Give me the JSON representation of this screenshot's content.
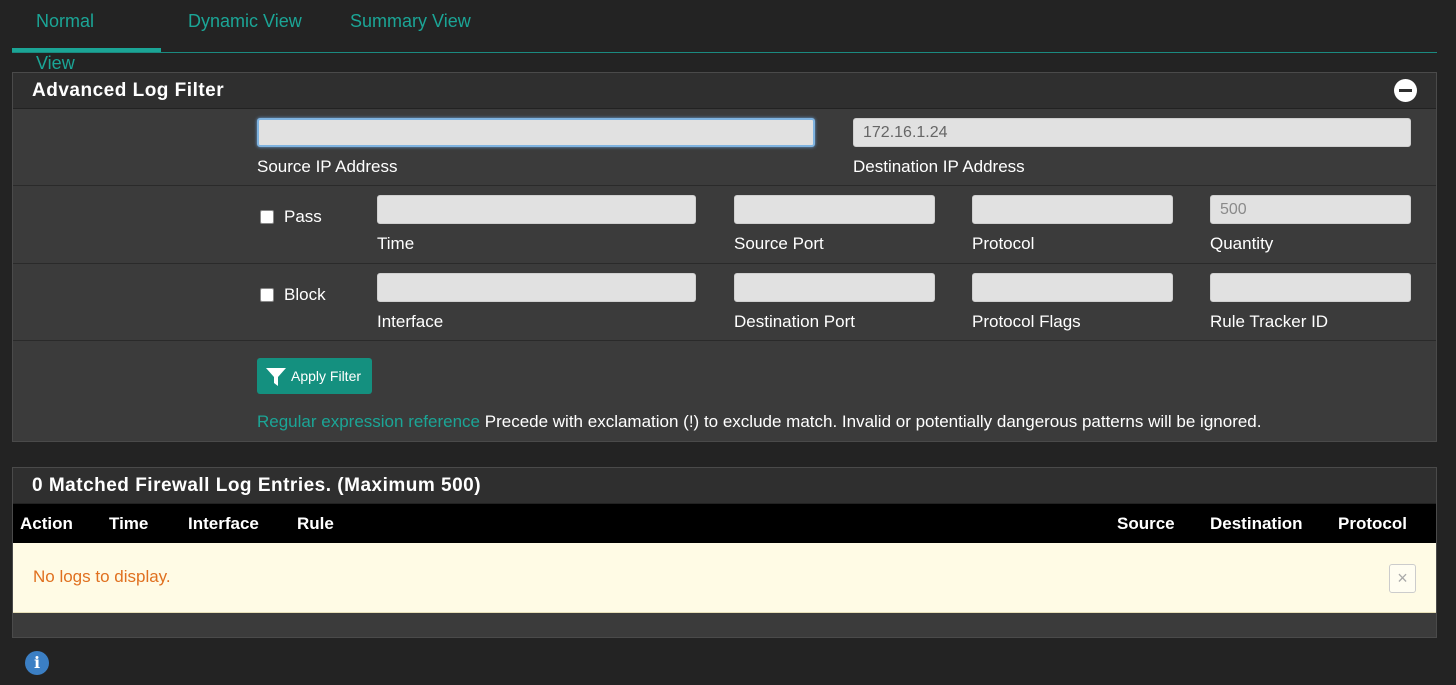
{
  "tabs": [
    {
      "label": "Normal View",
      "active": true
    },
    {
      "label": "Dynamic View",
      "active": false
    },
    {
      "label": "Summary View",
      "active": false
    }
  ],
  "filter_panel": {
    "title": "Advanced Log Filter",
    "source_ip": {
      "label": "Source IP Address",
      "value": ""
    },
    "destination_ip": {
      "label": "Destination IP Address",
      "value": "172.16.1.24"
    },
    "pass": {
      "label": "Pass",
      "checked": false
    },
    "block": {
      "label": "Block",
      "checked": false
    },
    "time": {
      "label": "Time",
      "value": ""
    },
    "source_port": {
      "label": "Source Port",
      "value": ""
    },
    "protocol": {
      "label": "Protocol",
      "value": ""
    },
    "quantity": {
      "label": "Quantity",
      "placeholder": "500"
    },
    "interface": {
      "label": "Interface",
      "value": ""
    },
    "destination_port": {
      "label": "Destination Port",
      "value": ""
    },
    "protocol_flags": {
      "label": "Protocol Flags",
      "value": ""
    },
    "rule_tracker_id": {
      "label": "Rule Tracker ID",
      "value": ""
    },
    "apply_label": "Apply Filter",
    "regex_link": "Regular expression reference",
    "hint_text": " Precede with exclamation (!) to exclude match. Invalid or potentially dangerous patterns will be ignored."
  },
  "log_panel": {
    "title": "0 Matched Firewall Log Entries. (Maximum 500)",
    "columns": [
      "Action",
      "Time",
      "Interface",
      "Rule",
      "Source",
      "Destination",
      "Protocol"
    ],
    "empty_message": "No logs to display.",
    "close_glyph": "×"
  },
  "info_glyph": "i",
  "colors": {
    "accent": "#1ba596",
    "alert_text": "#e0701f",
    "alert_bg": "#fffbe5"
  }
}
